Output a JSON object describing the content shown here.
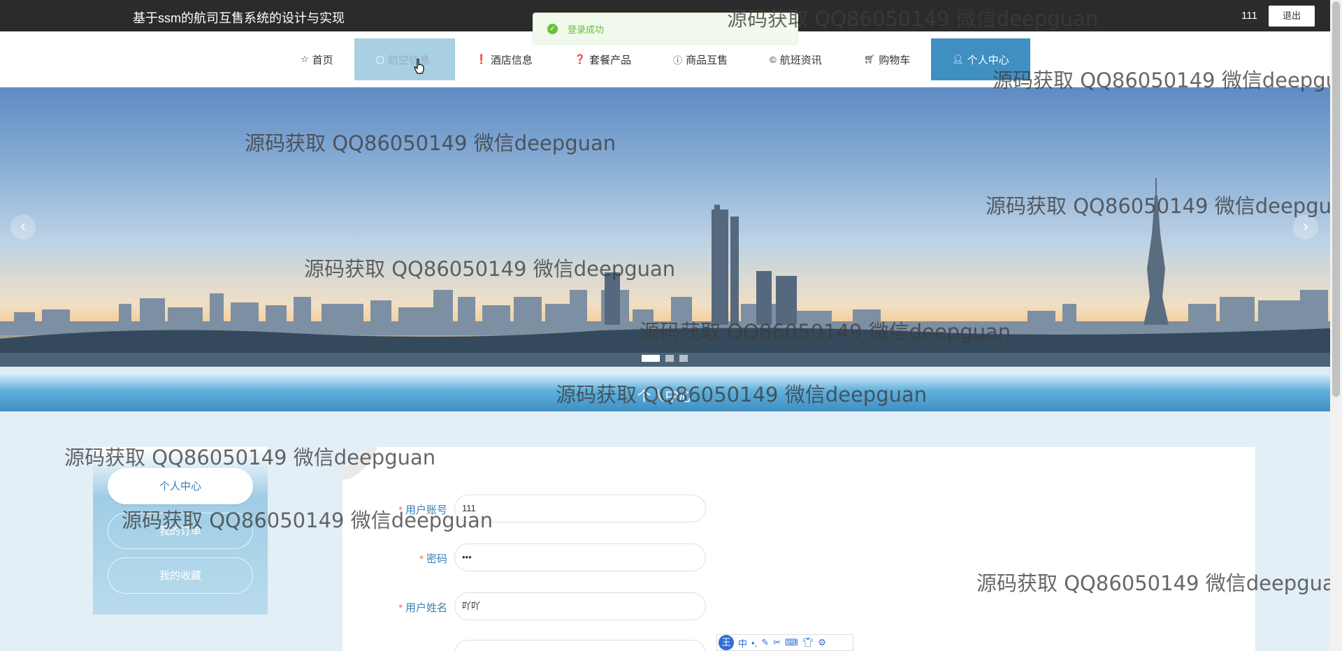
{
  "header": {
    "title": "基于ssm的航司互售系统的设计与实现",
    "username": "111",
    "logout_label": "退出"
  },
  "toast": {
    "message": "登录成功"
  },
  "nav": {
    "items": [
      {
        "label": "首页",
        "icon": "star-icon"
      },
      {
        "label": "航空信息",
        "icon": "square-icon"
      },
      {
        "label": "酒店信息",
        "icon": "exclaim-icon"
      },
      {
        "label": "套餐产品",
        "icon": "question-icon"
      },
      {
        "label": "商品互售",
        "icon": "info-icon"
      },
      {
        "label": "航班资讯",
        "icon": "copyright-icon"
      },
      {
        "label": "购物车",
        "icon": "cart-icon"
      },
      {
        "label": "个人中心",
        "icon": "user-icon"
      }
    ]
  },
  "banner": {
    "slides": 3,
    "current": 1
  },
  "section": {
    "title": "个人中心"
  },
  "sidebar": {
    "items": [
      "个人中心",
      "我的订单",
      "我的收藏"
    ]
  },
  "form": {
    "fields": [
      {
        "label": "用户账号",
        "value": "111",
        "required": true
      },
      {
        "label": "密码",
        "value": "•••",
        "required": true
      },
      {
        "label": "用户姓名",
        "value": "吖吖",
        "required": true
      }
    ]
  },
  "ime": {
    "king": "王",
    "mode": "中"
  },
  "watermark": "源码获取 QQ86050149 微信deepguan",
  "colors": {
    "accent": "#3f8fc3",
    "topbar": "#2b2b2b",
    "success": "#67c23a"
  }
}
